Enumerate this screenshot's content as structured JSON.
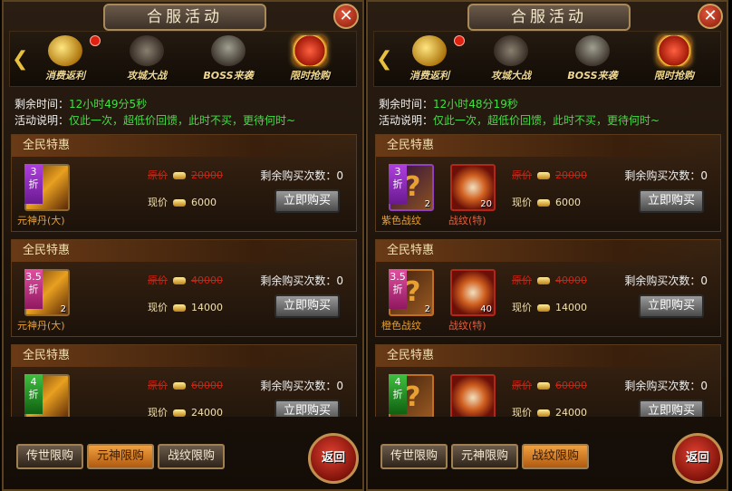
{
  "panels": [
    {
      "title": "合服活动",
      "close": "✕",
      "tabs": [
        "消费返利",
        "攻城大战",
        "BOSS来袭",
        "限时抢购"
      ],
      "remaining_label": "剩余时间：",
      "remaining_value": "12小时49分5秒",
      "desc_label": "活动说明：",
      "desc_value": "仅此一次，超低价回馈，此时不买，更待何时~",
      "cards": [
        {
          "header": "全民特惠",
          "discount": "3\n折",
          "items": [
            {
              "name": "元神丹(大)",
              "count": ""
            }
          ],
          "orig_label": "原价",
          "orig_price": "20000",
          "cur_label": "现价",
          "cur_price": "6000",
          "remain": "剩余购买次数：0",
          "button": "立即购买"
        },
        {
          "header": "全民特惠",
          "discount": "3.5\n折",
          "items": [
            {
              "name": "元神丹(大)",
              "count": "2"
            }
          ],
          "orig_label": "原价",
          "orig_price": "40000",
          "cur_label": "现价",
          "cur_price": "14000",
          "remain": "剩余购买次数：0",
          "button": "立即购买"
        },
        {
          "header": "全民特惠",
          "discount": "4\n折",
          "items": [
            {
              "name": "",
              "count": ""
            }
          ],
          "orig_label": "原价",
          "orig_price": "60000",
          "cur_label": "现价",
          "cur_price": "24000",
          "remain": "剩余购买次数：0",
          "button": "立即购买"
        }
      ],
      "bottom_tabs": [
        "传世限购",
        "元神限购",
        "战纹限购"
      ],
      "active_bottom": 1,
      "back": "返回"
    },
    {
      "title": "合服活动",
      "close": "✕",
      "tabs": [
        "消费返利",
        "攻城大战",
        "BOSS来袭",
        "限时抢购"
      ],
      "remaining_label": "剩余时间：",
      "remaining_value": "12小时48分19秒",
      "desc_label": "活动说明：",
      "desc_value": "仅此一次，超低价回馈，此时不买，更待何时~",
      "cards": [
        {
          "header": "全民特惠",
          "discount": "3\n折",
          "items": [
            {
              "name": "紫色战纹",
              "count": "2"
            },
            {
              "name": "战纹(特)",
              "count": "20"
            }
          ],
          "orig_label": "原价",
          "orig_price": "20000",
          "cur_label": "现价",
          "cur_price": "6000",
          "remain": "剩余购买次数：0",
          "button": "立即购买"
        },
        {
          "header": "全民特惠",
          "discount": "3.5\n折",
          "items": [
            {
              "name": "橙色战纹",
              "count": "2"
            },
            {
              "name": "战纹(特)",
              "count": "40"
            }
          ],
          "orig_label": "原价",
          "orig_price": "40000",
          "cur_label": "现价",
          "cur_price": "14000",
          "remain": "剩余购买次数：0",
          "button": "立即购买"
        },
        {
          "header": "全民特惠",
          "discount": "4\n折",
          "items": [
            {
              "name": "",
              "count": ""
            },
            {
              "name": "",
              "count": ""
            }
          ],
          "orig_label": "原价",
          "orig_price": "60000",
          "cur_label": "现价",
          "cur_price": "24000",
          "remain": "剩余购买次数：0",
          "button": "立即购买"
        }
      ],
      "bottom_tabs": [
        "传世限购",
        "元神限购",
        "战纹限购"
      ],
      "active_bottom": 2,
      "back": "返回"
    }
  ]
}
